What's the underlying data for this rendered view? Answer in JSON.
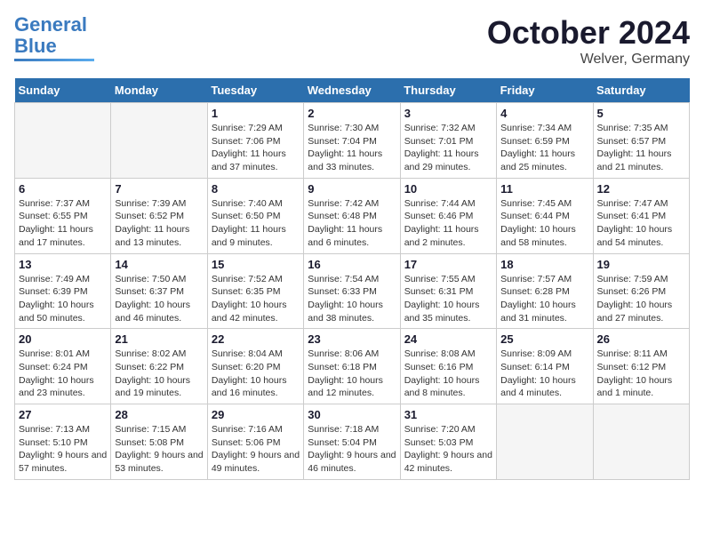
{
  "header": {
    "logo_line1": "General",
    "logo_line2": "Blue",
    "month": "October 2024",
    "location": "Welver, Germany"
  },
  "days_of_week": [
    "Sunday",
    "Monday",
    "Tuesday",
    "Wednesday",
    "Thursday",
    "Friday",
    "Saturday"
  ],
  "weeks": [
    [
      {
        "day": null
      },
      {
        "day": null
      },
      {
        "day": "1",
        "sunrise": "7:29 AM",
        "sunset": "7:06 PM",
        "daylight": "11 hours and 37 minutes."
      },
      {
        "day": "2",
        "sunrise": "7:30 AM",
        "sunset": "7:04 PM",
        "daylight": "11 hours and 33 minutes."
      },
      {
        "day": "3",
        "sunrise": "7:32 AM",
        "sunset": "7:01 PM",
        "daylight": "11 hours and 29 minutes."
      },
      {
        "day": "4",
        "sunrise": "7:34 AM",
        "sunset": "6:59 PM",
        "daylight": "11 hours and 25 minutes."
      },
      {
        "day": "5",
        "sunrise": "7:35 AM",
        "sunset": "6:57 PM",
        "daylight": "11 hours and 21 minutes."
      }
    ],
    [
      {
        "day": "6",
        "sunrise": "7:37 AM",
        "sunset": "6:55 PM",
        "daylight": "11 hours and 17 minutes."
      },
      {
        "day": "7",
        "sunrise": "7:39 AM",
        "sunset": "6:52 PM",
        "daylight": "11 hours and 13 minutes."
      },
      {
        "day": "8",
        "sunrise": "7:40 AM",
        "sunset": "6:50 PM",
        "daylight": "11 hours and 9 minutes."
      },
      {
        "day": "9",
        "sunrise": "7:42 AM",
        "sunset": "6:48 PM",
        "daylight": "11 hours and 6 minutes."
      },
      {
        "day": "10",
        "sunrise": "7:44 AM",
        "sunset": "6:46 PM",
        "daylight": "11 hours and 2 minutes."
      },
      {
        "day": "11",
        "sunrise": "7:45 AM",
        "sunset": "6:44 PM",
        "daylight": "10 hours and 58 minutes."
      },
      {
        "day": "12",
        "sunrise": "7:47 AM",
        "sunset": "6:41 PM",
        "daylight": "10 hours and 54 minutes."
      }
    ],
    [
      {
        "day": "13",
        "sunrise": "7:49 AM",
        "sunset": "6:39 PM",
        "daylight": "10 hours and 50 minutes."
      },
      {
        "day": "14",
        "sunrise": "7:50 AM",
        "sunset": "6:37 PM",
        "daylight": "10 hours and 46 minutes."
      },
      {
        "day": "15",
        "sunrise": "7:52 AM",
        "sunset": "6:35 PM",
        "daylight": "10 hours and 42 minutes."
      },
      {
        "day": "16",
        "sunrise": "7:54 AM",
        "sunset": "6:33 PM",
        "daylight": "10 hours and 38 minutes."
      },
      {
        "day": "17",
        "sunrise": "7:55 AM",
        "sunset": "6:31 PM",
        "daylight": "10 hours and 35 minutes."
      },
      {
        "day": "18",
        "sunrise": "7:57 AM",
        "sunset": "6:28 PM",
        "daylight": "10 hours and 31 minutes."
      },
      {
        "day": "19",
        "sunrise": "7:59 AM",
        "sunset": "6:26 PM",
        "daylight": "10 hours and 27 minutes."
      }
    ],
    [
      {
        "day": "20",
        "sunrise": "8:01 AM",
        "sunset": "6:24 PM",
        "daylight": "10 hours and 23 minutes."
      },
      {
        "day": "21",
        "sunrise": "8:02 AM",
        "sunset": "6:22 PM",
        "daylight": "10 hours and 19 minutes."
      },
      {
        "day": "22",
        "sunrise": "8:04 AM",
        "sunset": "6:20 PM",
        "daylight": "10 hours and 16 minutes."
      },
      {
        "day": "23",
        "sunrise": "8:06 AM",
        "sunset": "6:18 PM",
        "daylight": "10 hours and 12 minutes."
      },
      {
        "day": "24",
        "sunrise": "8:08 AM",
        "sunset": "6:16 PM",
        "daylight": "10 hours and 8 minutes."
      },
      {
        "day": "25",
        "sunrise": "8:09 AM",
        "sunset": "6:14 PM",
        "daylight": "10 hours and 4 minutes."
      },
      {
        "day": "26",
        "sunrise": "8:11 AM",
        "sunset": "6:12 PM",
        "daylight": "10 hours and 1 minute."
      }
    ],
    [
      {
        "day": "27",
        "sunrise": "7:13 AM",
        "sunset": "5:10 PM",
        "daylight": "9 hours and 57 minutes."
      },
      {
        "day": "28",
        "sunrise": "7:15 AM",
        "sunset": "5:08 PM",
        "daylight": "9 hours and 53 minutes."
      },
      {
        "day": "29",
        "sunrise": "7:16 AM",
        "sunset": "5:06 PM",
        "daylight": "9 hours and 49 minutes."
      },
      {
        "day": "30",
        "sunrise": "7:18 AM",
        "sunset": "5:04 PM",
        "daylight": "9 hours and 46 minutes."
      },
      {
        "day": "31",
        "sunrise": "7:20 AM",
        "sunset": "5:03 PM",
        "daylight": "9 hours and 42 minutes."
      },
      {
        "day": null
      },
      {
        "day": null
      }
    ]
  ]
}
